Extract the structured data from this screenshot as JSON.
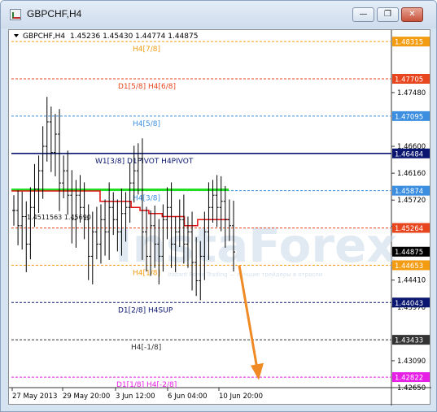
{
  "window": {
    "title": "GBPCHF,H4",
    "buttons": {
      "minimize": "—",
      "restore": "❐",
      "close": "✕"
    }
  },
  "chart_header": {
    "symbol": "GBPCHF,H4",
    "ohlc": "1.45236 1.45430 1.44774 1.44875"
  },
  "watermark": {
    "text": "InstaForex",
    "subtitle": "Instant Forex Trading — лучшие трейдеры в отрасли"
  },
  "chart_data": {
    "type": "line",
    "title": "GBPCHF,H4",
    "y_axis": {
      "min": 1.4265,
      "max": 1.4845,
      "ticks": [
        "1.47480",
        "1.46600",
        "1.46160",
        "1.45720",
        "1.45290",
        "1.44410",
        "1.43970",
        "1.43090",
        "1.42650"
      ]
    },
    "x_axis": {
      "ticks": [
        "27 May 2013",
        "29 May 20:00",
        "3 Jun 12:00",
        "6 Jun 04:00",
        "10 Jun 20:00"
      ]
    },
    "levels": [
      {
        "label": "H4[7/8]",
        "price": "1.48315",
        "value": 1.48315,
        "color": "#f39c12",
        "dash": true
      },
      {
        "label": "D1[5/8] H4[6/8]",
        "price": "1.47705",
        "value": 1.47705,
        "color": "#e8461e",
        "dash": true
      },
      {
        "label": "H4[5/8]",
        "price": "1.47095",
        "value": 1.47095,
        "color": "#3b8ee0",
        "dash": true
      },
      {
        "label": "W1[3/8] D1PIVOT H4PIVOT",
        "price": "1.46484",
        "value": 1.46484,
        "color": "#0a1670",
        "dash": false
      },
      {
        "label": "H4[3/8]",
        "price": "1.45874",
        "value": 1.45874,
        "color": "#3b8ee0",
        "dash": true
      },
      {
        "label": "",
        "price": "1.45264",
        "value": 1.45264,
        "color": "#e8461e",
        "dash": true
      },
      {
        "label": "H4[1/8]",
        "price": "1.44653",
        "value": 1.44653,
        "color": "#f39c12",
        "dash": true
      },
      {
        "label": "D1[2/8] H4SUP",
        "price": "1.44043",
        "value": 1.44043,
        "color": "#0a1670",
        "dash": true
      },
      {
        "label": "H4[-1/8]",
        "price": "1.43433",
        "value": 1.43433,
        "color": "#333333",
        "dash": true
      },
      {
        "label": "D1[1/8] H4[-2/8]",
        "price": "1.42822",
        "value": 1.42822,
        "color": "#e61ee6",
        "dash": true
      }
    ],
    "current_price": {
      "label": "1.44875",
      "value": 1.44875
    },
    "inner_label": "1.4511563 1.45690",
    "close_series": [
      1.4555,
      1.453,
      1.4545,
      1.45,
      1.456,
      1.459,
      1.462,
      1.466,
      1.47,
      1.465,
      1.468,
      1.46,
      1.462,
      1.458,
      1.454,
      1.458,
      1.456,
      1.454,
      1.448,
      1.452,
      1.45,
      1.454,
      1.452,
      1.456,
      1.454,
      1.452,
      1.455,
      1.456,
      1.46,
      1.462,
      1.464,
      1.452,
      1.448,
      1.453,
      1.45,
      1.448,
      1.454,
      1.456,
      1.45,
      1.452,
      1.454,
      1.45,
      1.452,
      1.447,
      1.444,
      1.448,
      1.452,
      1.456,
      1.458,
      1.456,
      1.457,
      1.454,
      1.453,
      1.4487
    ],
    "red_step_line": [
      1.4587,
      1.4587,
      1.4587,
      1.4587,
      1.4587,
      1.4587,
      1.4587,
      1.4587,
      1.4587,
      1.4587,
      1.4587,
      1.4587,
      1.4587,
      1.4587,
      1.4587,
      1.4587,
      1.4587,
      1.4587,
      1.4587,
      1.4587,
      1.457,
      1.457,
      1.457,
      1.457,
      1.457,
      1.457,
      1.457,
      1.456,
      1.456,
      1.4555,
      1.4555,
      1.455,
      1.455,
      1.455,
      1.4545,
      1.4545,
      1.4545,
      1.4545,
      1.4545,
      1.453,
      1.453,
      1.453,
      1.454,
      1.454,
      1.454,
      1.454,
      1.454,
      1.454,
      1.454,
      1.454
    ],
    "green_line": {
      "value": 1.4589
    },
    "forecast_arrow": {
      "from": 1.4465,
      "to": 1.428
    }
  }
}
